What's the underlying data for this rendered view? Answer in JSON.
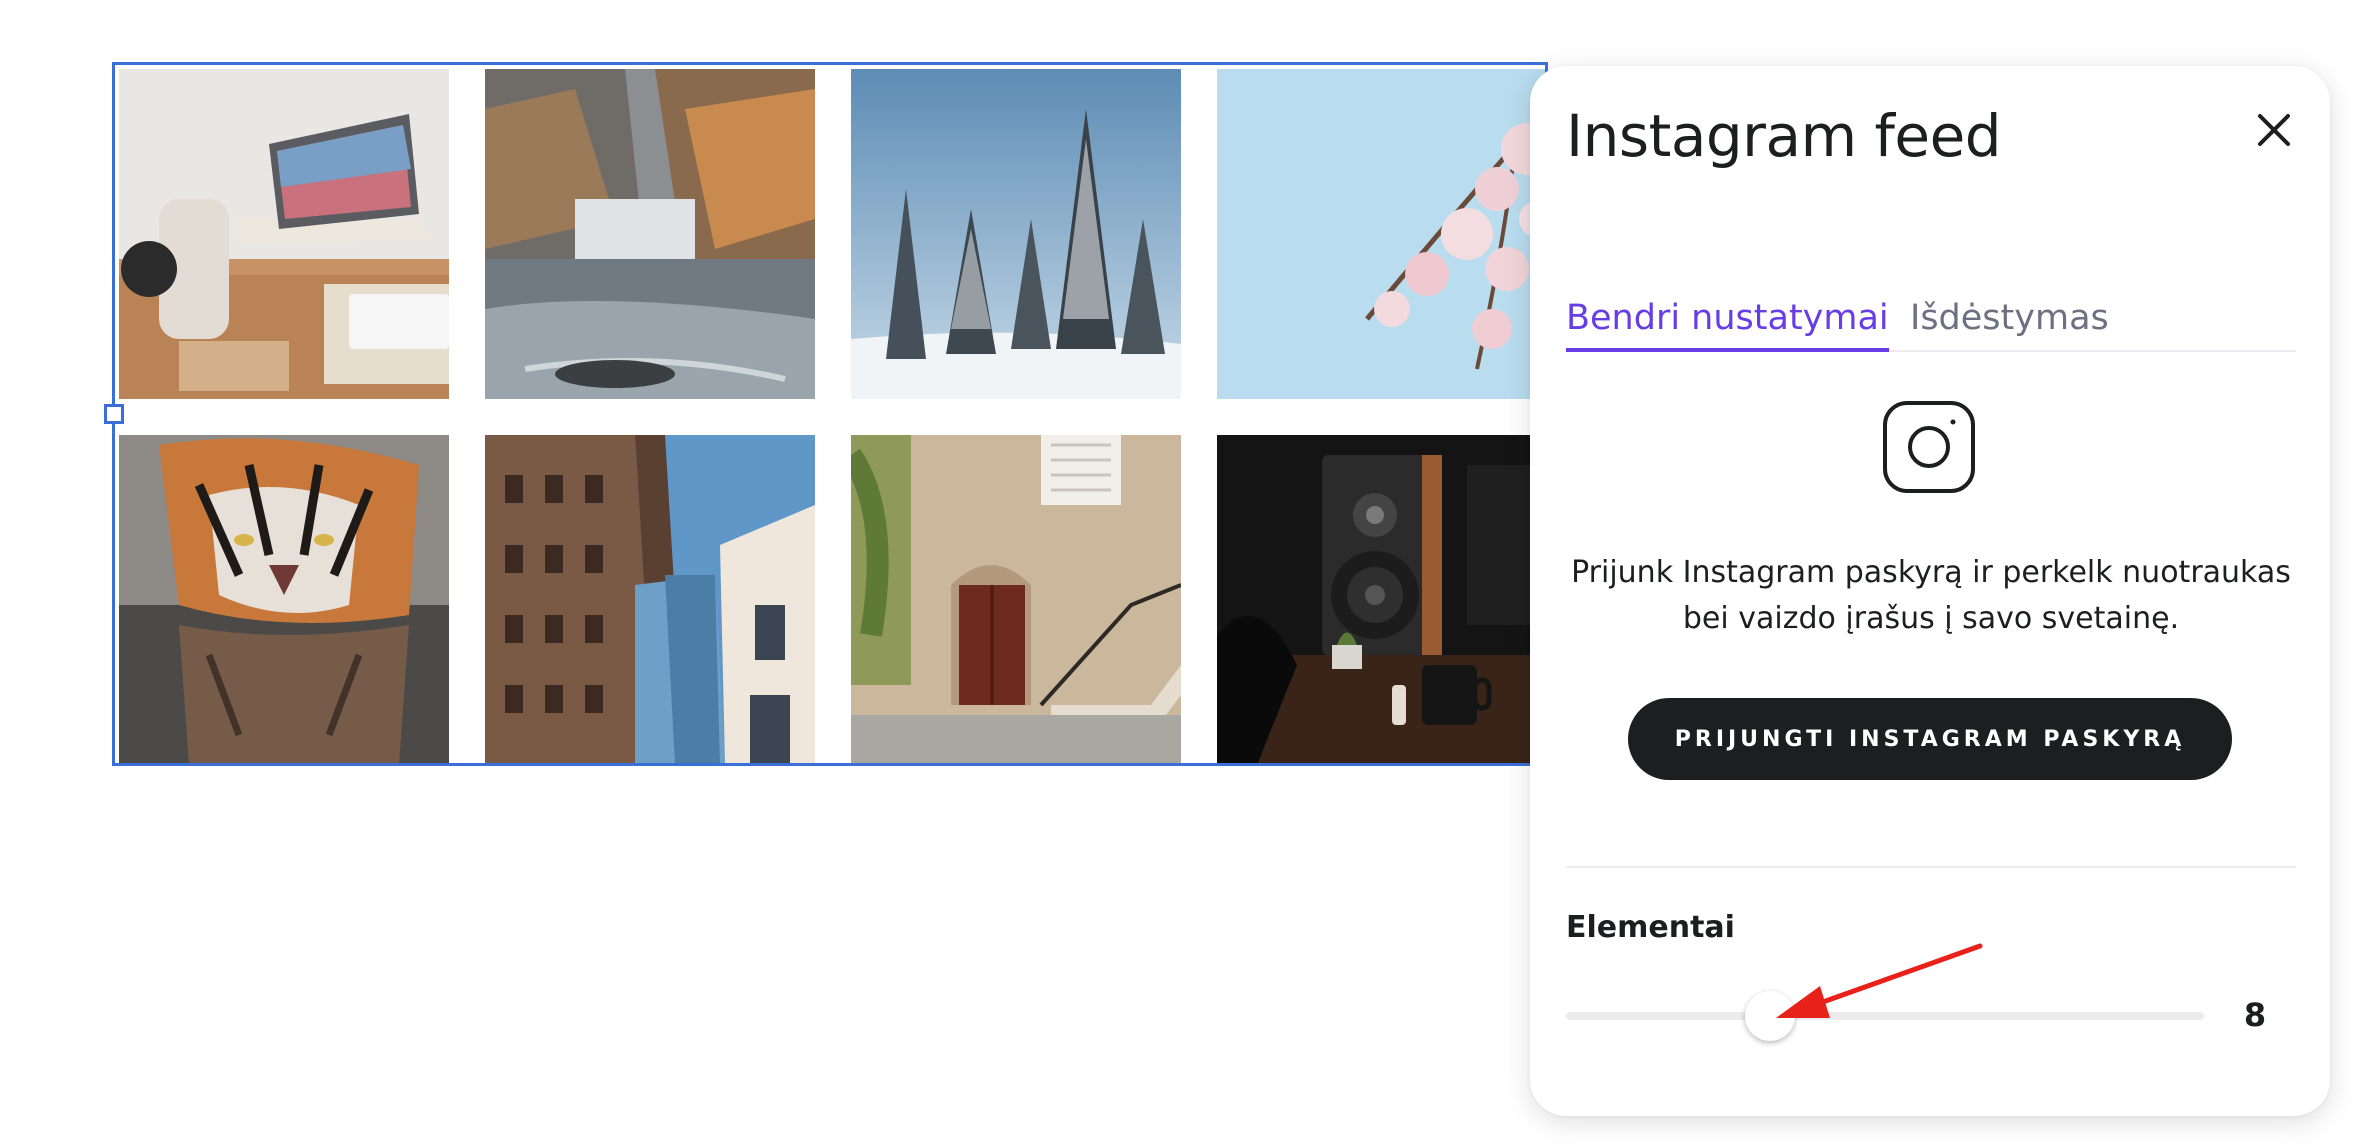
{
  "panel": {
    "title": "Instagram feed",
    "close_icon": "close-icon",
    "tabs": [
      {
        "label": "Bendri nustatymai",
        "active": true
      },
      {
        "label": "Išdėstymas",
        "active": false
      }
    ],
    "instagram_icon": "instagram-icon",
    "description": "Prijunk Instagram paskyrą ir perkelk nuotraukas bei vaizdo įrašus į savo svetainę.",
    "connect_button": "PRIJUNGTI INSTAGRAM PASKYRĄ",
    "slider": {
      "label": "Elementai",
      "value": "8",
      "fraction": 0.32
    }
  },
  "feed": {
    "selection_color": "#3b6fd8",
    "images": [
      {
        "subject": "desk-laptop-headphones"
      },
      {
        "subject": "waterfall-cliffs"
      },
      {
        "subject": "snowy-pine-trees"
      },
      {
        "subject": "cherry-blossom-sky"
      },
      {
        "subject": "tiger-drinking-water"
      },
      {
        "subject": "city-buildings"
      },
      {
        "subject": "stone-house-door"
      },
      {
        "subject": "speaker-mug-dark"
      }
    ]
  },
  "colors": {
    "accent": "#673de6",
    "button_bg": "#1d1e20",
    "annotation": "#e8211b"
  }
}
